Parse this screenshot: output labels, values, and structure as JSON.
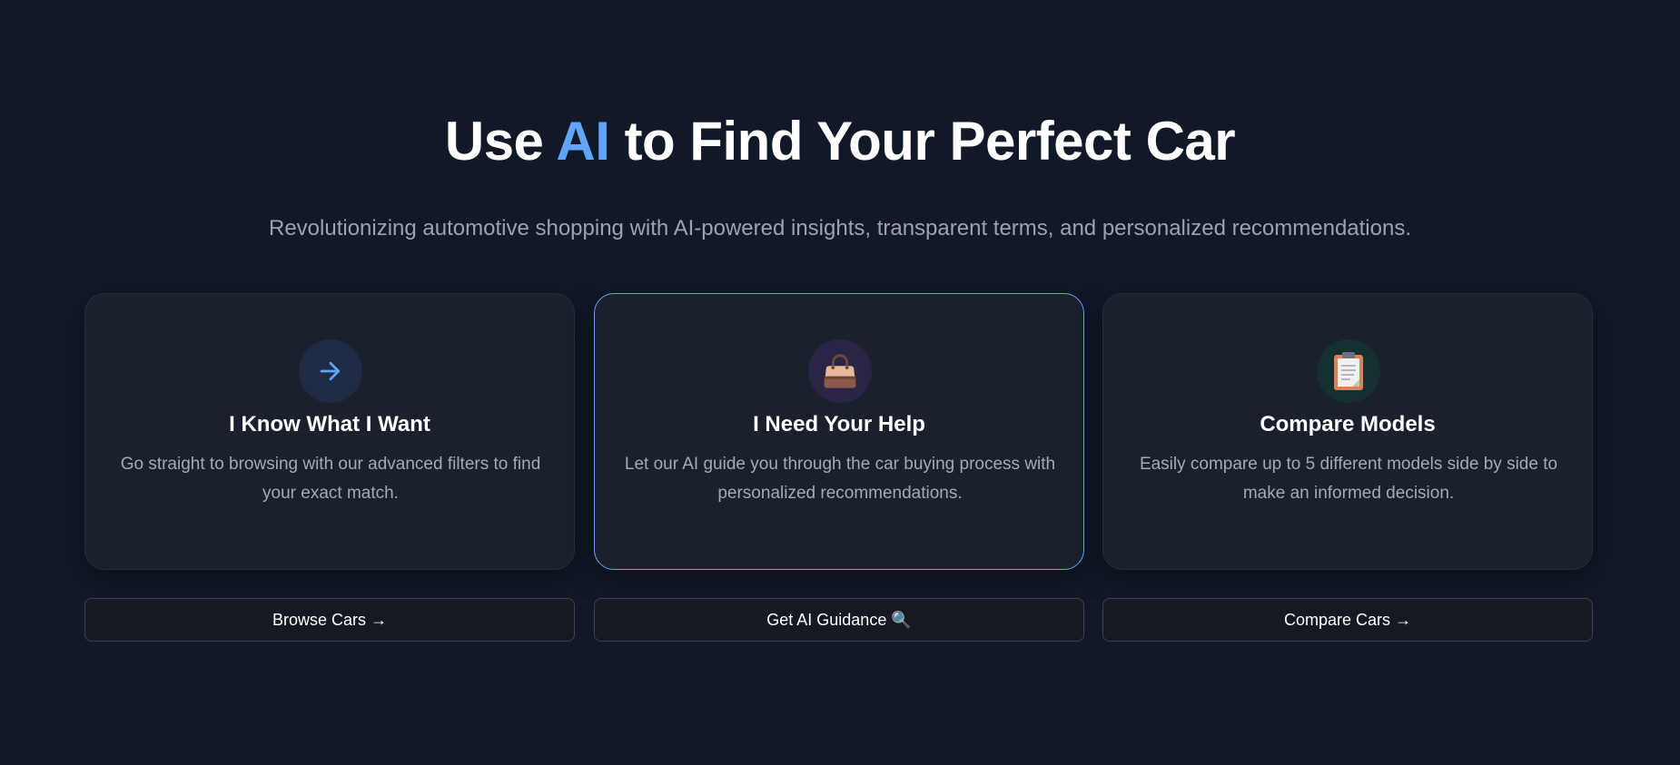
{
  "hero": {
    "title_prefix": "Use",
    "title_accent": "AI",
    "title_suffix": "to Find Your Perfect Car",
    "subtitle": "Revolutionizing automotive shopping with AI-powered insights, transparent terms, and personalized recommendations."
  },
  "colors": {
    "background": "#111827",
    "accent": "#60a5fa",
    "card": "#1a202c",
    "muted_text": "#9ca3af"
  },
  "cards": [
    {
      "icon": "arrow-right-icon",
      "title": "I Know What I Want",
      "description": "Go straight to browsing with our advanced filters to find your exact match."
    },
    {
      "icon": "handbag-icon",
      "title": "I Need Your Help",
      "description": "Let our AI guide you through the car buying process with personalized recommendations."
    },
    {
      "icon": "clipboard-icon",
      "title": "Compare Models",
      "description": "Easily compare up to 5 different models side by side to make an informed decision."
    }
  ],
  "buttons": [
    {
      "label": "Browse Cars →"
    },
    {
      "label": "Get AI Guidance 🔍"
    },
    {
      "label": "Compare Cars →"
    }
  ]
}
